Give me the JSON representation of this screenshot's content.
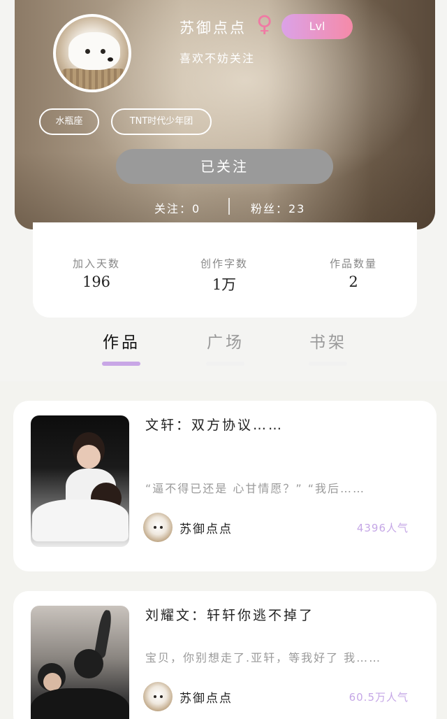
{
  "profile": {
    "username": "苏御点点",
    "gender_icon": "female-symbol-icon",
    "level": "Lvl",
    "bio": "喜欢不妨关注",
    "tags": [
      "水瓶座",
      "TNT时代少年团"
    ],
    "follow_button_label": "已关注",
    "following_label": "关注：0",
    "fans_label": "粉丝：23"
  },
  "stats": [
    {
      "label": "加入天数",
      "value": "196"
    },
    {
      "label": "创作字数",
      "value": "1万"
    },
    {
      "label": "作品数量",
      "value": "2"
    }
  ],
  "tabs": [
    {
      "label": "作品",
      "active": true
    },
    {
      "label": "广场",
      "active": false
    },
    {
      "label": "书架",
      "active": false
    }
  ],
  "works": [
    {
      "title": "文轩：双方协议……",
      "excerpt": "“逼不得已还是 心甘情愿？” “我后……",
      "author": "苏御点点",
      "popularity": "4396人气"
    },
    {
      "title": "刘耀文：轩轩你逃不掉了",
      "excerpt": "宝贝，你别想走了.亚轩，等我好了 我……",
      "author": "苏御点点",
      "popularity": "60.5万人气"
    }
  ],
  "colors": {
    "accent_purple": "#c8a6e6",
    "gender_pink": "#f07aa4",
    "follow_button_gray": "#9a9a9a"
  }
}
